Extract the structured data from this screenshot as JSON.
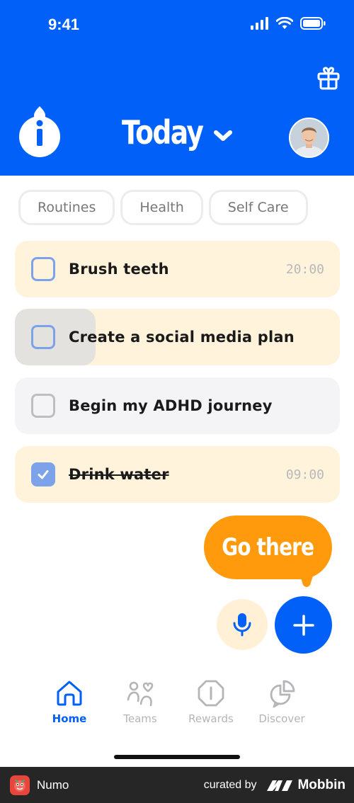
{
  "status_bar": {
    "time": "9:41"
  },
  "header": {
    "title": "Today"
  },
  "filters": [
    {
      "label": "Routines"
    },
    {
      "label": "Health"
    },
    {
      "label": "Self Care"
    }
  ],
  "tasks": [
    {
      "label": "Brush teeth",
      "time": "20:00",
      "checked": false
    },
    {
      "label": "Create a social media plan",
      "time": "",
      "checked": false
    },
    {
      "label": "Begin my ADHD journey",
      "time": "",
      "checked": false
    },
    {
      "label": "Drink water",
      "time": "09:00",
      "checked": true
    }
  ],
  "tooltip": {
    "label": "Go there"
  },
  "actions": {
    "mic_icon": "microphone-icon",
    "add_icon": "plus-icon"
  },
  "nav": [
    {
      "label": "Home",
      "icon": "home-icon",
      "active": true
    },
    {
      "label": "Teams",
      "icon": "teams-icon",
      "active": false
    },
    {
      "label": "Rewards",
      "icon": "rewards-icon",
      "active": false
    },
    {
      "label": "Discover",
      "icon": "discover-icon",
      "active": false
    }
  ],
  "footer": {
    "app_name": "Numo",
    "curated_by": "curated by",
    "brand": "Mobbin"
  },
  "colors": {
    "primary": "#0060F7",
    "accent": "#FF9A0D",
    "task_yellow": "#FFF3DC",
    "task_grey": "#F4F4F6",
    "checkbox": "#7CA3EA"
  }
}
